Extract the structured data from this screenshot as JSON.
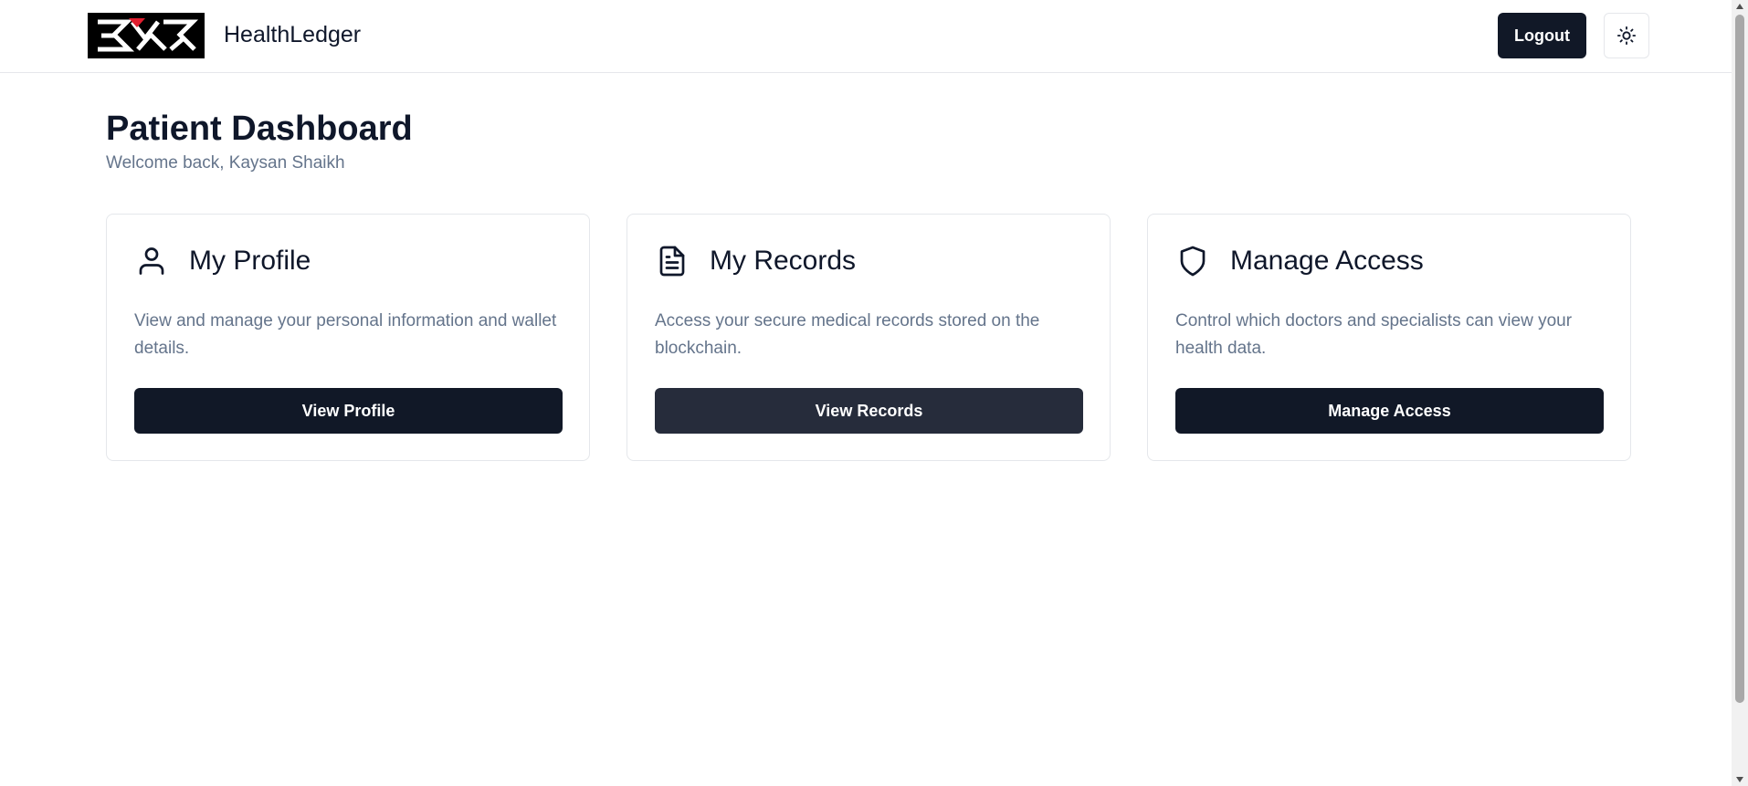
{
  "header": {
    "app_name": "HealthLedger",
    "logo_icon": "health-ledger-logo",
    "logout_label": "Logout",
    "theme_icon": "sun-icon"
  },
  "main": {
    "title": "Patient Dashboard",
    "welcome": "Welcome back, Kaysan Shaikh"
  },
  "cards": [
    {
      "icon": "user-icon",
      "title": "My Profile",
      "description": "View and manage your personal information and wallet details.",
      "button": "View Profile"
    },
    {
      "icon": "document-icon",
      "title": "My Records",
      "description": "Access your secure medical records stored on the blockchain.",
      "button": "View Records"
    },
    {
      "icon": "shield-icon",
      "title": "Manage Access",
      "description": "Control which doctors and specialists can view your health data.",
      "button": "Manage Access"
    }
  ],
  "colors": {
    "primary": "#111827",
    "primary_hover": "#262c3b",
    "muted_text": "#64748b",
    "border": "#e5e7eb",
    "logo_accent": "#e11d2e"
  }
}
